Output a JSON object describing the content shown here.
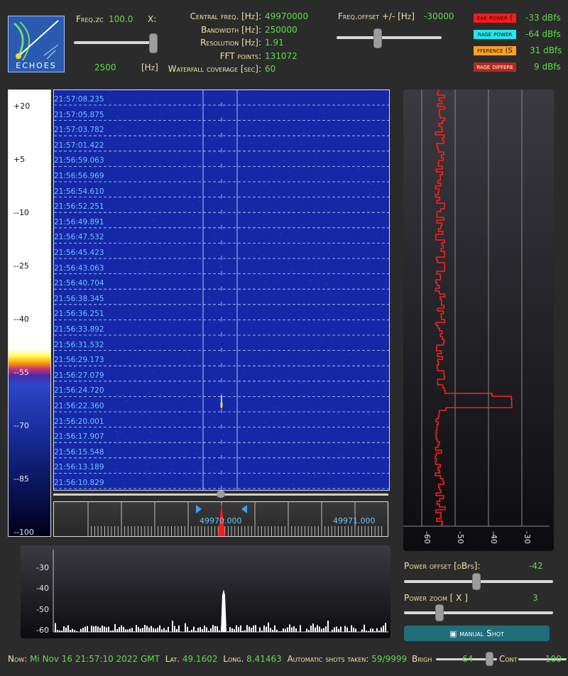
{
  "app": {
    "logo_text": "ECHOES"
  },
  "zoom": {
    "label": "Freq.zc",
    "value": "100.0",
    "unit_right": "X:",
    "min_value": "2500",
    "unit": "[Hz]"
  },
  "info": {
    "rows": [
      {
        "label": "Central freq. [Hz]:",
        "value": "49970000"
      },
      {
        "label": "Bandwidth  [Hz]:",
        "value": "250000"
      },
      {
        "label": "Resolution [Hz]:",
        "value": "1.91"
      },
      {
        "label": "FFT points:",
        "value": "131072"
      },
      {
        "label": "Waterfall coverage [sec]:",
        "value": "60"
      }
    ]
  },
  "offset": {
    "label": "Freq.offset +/- [Hz]",
    "value": "-30000"
  },
  "readouts": [
    {
      "label": "eak power (",
      "value": "-33 dBfs",
      "color": "#ff1a1a"
    },
    {
      "label": "rage power",
      "value": "-64 dBfs",
      "color": "#22e6f0"
    },
    {
      "label": "fference (S",
      "value": "31 dBfs",
      "color": "#ffa020"
    },
    {
      "label": "rage differe",
      "value": "9 dBfs",
      "color": "#b42a1e"
    }
  ],
  "palette_ticks": [
    "+20",
    "+5",
    "--10",
    "--25",
    "--40",
    "--55",
    "--70",
    "--85",
    "--100"
  ],
  "waterfall": {
    "timestamps": [
      "21:57:08.235",
      "21:57:05.875",
      "21:57:03.782",
      "21:57:01.422",
      "21:56:59.063",
      "21:56:56.969",
      "21:56:54.610",
      "21:56:52.251",
      "21:56:49.891",
      "21:56:47.532",
      "21:56:45.423",
      "21:56:43.063",
      "21:56:40.704",
      "21:56:38.345",
      "21:56:36.251",
      "21:56:33.892",
      "21:56:31.532",
      "21:56:29.173",
      "21:56:27.079",
      "21:56:24.720",
      "21:56:22.360",
      "21:56:20.001",
      "21:56:17.907",
      "21:56:15.548",
      "21:56:13.189",
      "21:56:10.829"
    ]
  },
  "freq_scale": {
    "center_label": "49970.000",
    "right_label": "49971.000"
  },
  "power_axis": {
    "ticks": [
      "-60",
      "-50",
      "-40",
      "-30"
    ]
  },
  "spectrum": {
    "y_ticks": [
      "-30",
      "-40",
      "-50",
      "-60"
    ]
  },
  "power_offset": {
    "label": "Power offset [dBfs]:",
    "value": "-42"
  },
  "power_zoom": {
    "label": "Power zoom  [ X ]",
    "value": "3"
  },
  "manual_shot": {
    "label": "manual Shot"
  },
  "status": {
    "now_label": "Now:",
    "now_value": "Mi Nov 16 21:57:10 2022 GMT",
    "lat_label": "Lat.",
    "lat_value": "49.1602",
    "long_label": "Long.",
    "long_value": "8.41463",
    "shots_label": "Automatic shots taken:",
    "shots_value": "59/9999",
    "bright_label": "Brigh",
    "bright_value": "64",
    "contrast_label": "Cont",
    "contrast_value": "100"
  },
  "colors": {
    "accent_green": "#5fdc4a",
    "label_yellow": "#f0e6a0",
    "waterfall_blue": "#1528a8",
    "trace_red": "#ff2020"
  }
}
